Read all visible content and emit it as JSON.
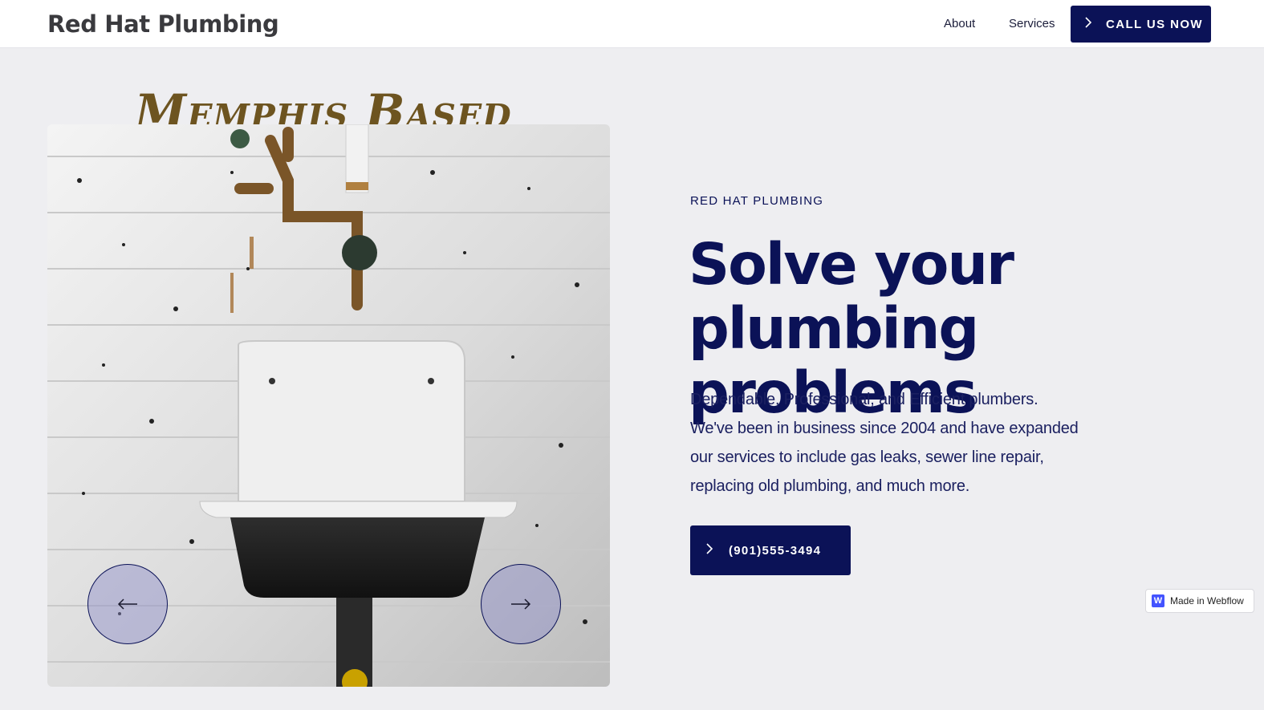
{
  "nav": {
    "logo": "Red Hat Plumbing",
    "links": [
      "About",
      "Services"
    ],
    "cta_label": "CALL US NOW",
    "cta_icon": "chevron-right-icon"
  },
  "hero": {
    "script_heading": "Memphis Based",
    "image_alt": "Vintage utility sink with brass pipes on a painted brick wall",
    "slider": {
      "prev_icon": "arrow-left-icon",
      "next_icon": "arrow-right-icon"
    },
    "eyebrow": "RED HAT PLUMBING",
    "headline_line1": "Solve your",
    "headline_line2": "plumbing problems",
    "body_lines": [
      "Dependable, Professional, and Efficient plumbers.",
      "We've been in business since 2004 and have expanded",
      "our services to include gas leaks, sewer line repair,",
      "replacing old plumbing, and much more."
    ],
    "phone_label": "(901)555-3494"
  },
  "badge": {
    "logo_letter": "W",
    "text": "Made in Webflow"
  },
  "colors": {
    "navy": "#0b1257",
    "background": "#eeeef1",
    "script_brown": "#6d5420",
    "webflow_blue": "#4353ff"
  }
}
